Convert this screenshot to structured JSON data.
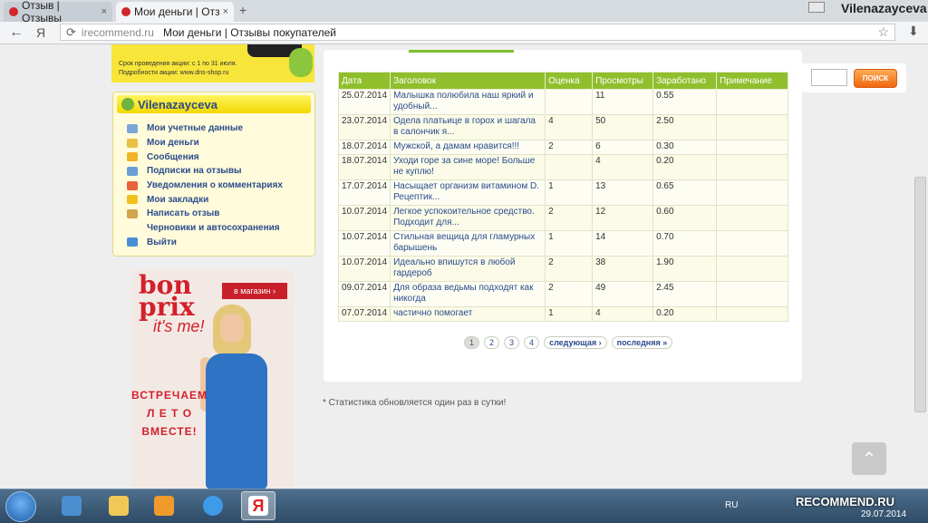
{
  "browser": {
    "tabs": [
      {
        "label": "Отзыв | Отзывы",
        "active": false
      },
      {
        "label": "Мои деньги | Отз",
        "active": true
      }
    ],
    "new_tab_symbol": "+",
    "close_symbol": "×",
    "user_name": "Vilenazayceva",
    "address": {
      "domain": "irecommend.ru",
      "title": "Мои деньги | Отзывы покупателей"
    },
    "yandex_letter": "Я"
  },
  "promo_banner": {
    "line1": "Срок проведения акции: с 1 по 31 июля.",
    "line2": "Подробности акции: www.dns-shop.ru"
  },
  "user_panel": {
    "username": "Vilenazayceva",
    "menu": [
      {
        "label": "Мои учетные данные",
        "icon": "id-card-icon",
        "color": "#7aa7d8"
      },
      {
        "label": "Мои деньги",
        "icon": "money-icon",
        "color": "#e9c043"
      },
      {
        "label": "Сообщения",
        "icon": "envelope-icon",
        "color": "#f0b42a"
      },
      {
        "label": "Подписки на отзывы",
        "icon": "subscription-icon",
        "color": "#6aa0d6"
      },
      {
        "label": "Уведомления о комментариях",
        "icon": "alert-icon",
        "color": "#e8623a"
      },
      {
        "label": "Мои закладки",
        "icon": "star-icon",
        "color": "#f2c21b"
      },
      {
        "label": "Написать отзыв",
        "icon": "pencil-icon",
        "color": "#d1a64e"
      },
      {
        "label": "Черновики и автосохранения",
        "icon": "blank-icon",
        "color": "#fffbdb"
      },
      {
        "label": "Выйти",
        "icon": "logout-icon",
        "color": "#4a8ed8"
      }
    ]
  },
  "ad": {
    "logo_line1": "bon",
    "logo_line2": "prix",
    "logo_tagline": "it's me!",
    "shop_button": "в магазин ›",
    "slogan": [
      "ВСТРЕЧАЕМ",
      "Л Е Т О",
      "ВМЕСТЕ!"
    ]
  },
  "stats_table": {
    "headers": [
      "Дата",
      "Заголовок",
      "Оценка",
      "Просмотры",
      "Заработано",
      "Примечание"
    ],
    "rows": [
      {
        "date": "25.07.2014",
        "title": "Малышка полюбила наш яркий и удобный...",
        "rating": "",
        "views": "11",
        "earned": "0.55",
        "note": ""
      },
      {
        "date": "23.07.2014",
        "title": "Одела платьице в горох и шагала в салончик я...",
        "rating": "4",
        "views": "50",
        "earned": "2.50",
        "note": ""
      },
      {
        "date": "18.07.2014",
        "title": "Мужской, а дамам нравится!!!",
        "rating": "2",
        "views": "6",
        "earned": "0.30",
        "note": ""
      },
      {
        "date": "18.07.2014",
        "title": "Уходи горе за сине море! Больше не куплю!",
        "rating": "",
        "views": "4",
        "earned": "0.20",
        "note": ""
      },
      {
        "date": "17.07.2014",
        "title": "Насыщает организм витамином D. Рецептик...",
        "rating": "1",
        "views": "13",
        "earned": "0.65",
        "note": ""
      },
      {
        "date": "10.07.2014",
        "title": "Легкое успокоительное средство. Подходит для...",
        "rating": "2",
        "views": "12",
        "earned": "0.60",
        "note": ""
      },
      {
        "date": "10.07.2014",
        "title": "Стильная вещица для гламурных барышень",
        "rating": "1",
        "views": "14",
        "earned": "0.70",
        "note": ""
      },
      {
        "date": "10.07.2014",
        "title": "Идеально впишутся в любой гардероб",
        "rating": "2",
        "views": "38",
        "earned": "1.90",
        "note": ""
      },
      {
        "date": "09.07.2014",
        "title": "Для образа ведьмы подходят как никогда",
        "rating": "2",
        "views": "49",
        "earned": "2.45",
        "note": ""
      },
      {
        "date": "07.07.2014",
        "title": "частично помогает",
        "rating": "1",
        "views": "4",
        "earned": "0.20",
        "note": ""
      }
    ]
  },
  "pagination": {
    "pages": [
      "1",
      "2",
      "3",
      "4"
    ],
    "current": "1",
    "next": "следующая ›",
    "last": "последняя »"
  },
  "footnote": "* Статистика обновляется один раз в сутки!",
  "search": {
    "value": "",
    "button": "ПОИСК"
  },
  "taskbar": {
    "lang": "RU",
    "watermark": "RECOMMEND.RU",
    "date": "29.07.2014"
  },
  "colors": {
    "table_header": "#8fbf2c",
    "accent_orange": "#f2660d",
    "link_blue": "#2b4c8c",
    "panel_yellow": "#fff45f"
  }
}
